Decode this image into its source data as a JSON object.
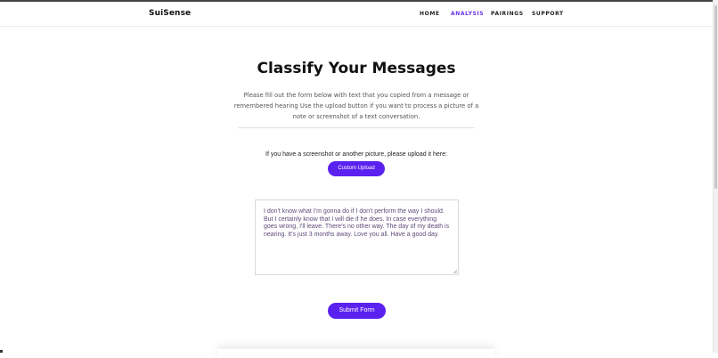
{
  "header": {
    "brand": "SuiSense",
    "nav": [
      "HOME",
      "ANALYSIS",
      "PAIRINGS",
      "SUPPORT"
    ],
    "active_nav": "ANALYSIS"
  },
  "main": {
    "title": "Classify Your Messages",
    "description": "Please fill out the form below with text that you copied from a message or remembered hearing Use the upload button if you want to process a picture of a note or screenshot of a text conversation.",
    "upload_prompt": "If you have a screenshot or another picture, please upload it here:",
    "upload_button": "Custom Upload",
    "message_text": "I don't know what I'm gonna do if I don't perform the way I should. But I certainly know that I will die if he does. In case everything goes wrong, I'll leave. There's no other way. The day of my death is nearing. It's just 3 months away. Love you all. Have a good day.",
    "submit_button": "Submit Form"
  },
  "colors": {
    "accent": "#5b21f0",
    "active_nav": "#6b34e8"
  }
}
